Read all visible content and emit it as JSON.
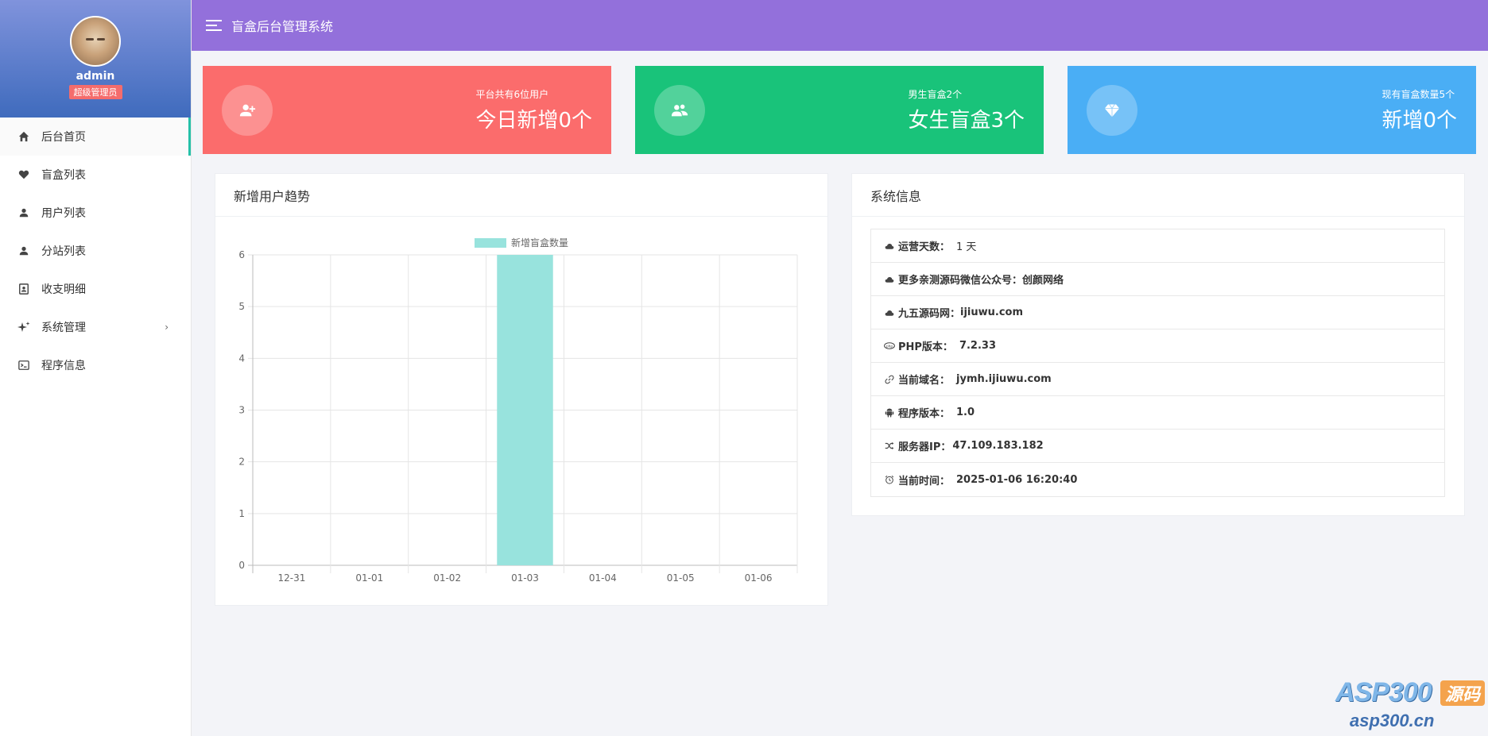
{
  "app": {
    "title": "盲盒后台管理系统"
  },
  "profile": {
    "username": "admin",
    "role": "超级管理员"
  },
  "sidebar": {
    "items": [
      {
        "label": "后台首页",
        "icon": "home-icon",
        "active": true
      },
      {
        "label": "盲盒列表",
        "icon": "heart-icon"
      },
      {
        "label": "用户列表",
        "icon": "user-icon"
      },
      {
        "label": "分站列表",
        "icon": "user-icon"
      },
      {
        "label": "收支明细",
        "icon": "contacts-icon"
      },
      {
        "label": "系统管理",
        "icon": "sparkle-icon",
        "has_submenu": true,
        "chevron": "›"
      },
      {
        "label": "程序信息",
        "icon": "terminal-icon"
      }
    ]
  },
  "stats": [
    {
      "small": "平台共有6位用户",
      "big": "今日新增0个",
      "color": "#fb6c6c",
      "icon": "user-plus-icon"
    },
    {
      "small": "男生盲盒2个",
      "big": "女生盲盒3个",
      "color": "#19c37a",
      "icon": "users-icon"
    },
    {
      "small": "现有盲盒数量5个",
      "big": "新增0个",
      "color": "#4aaef5",
      "icon": "diamond-icon"
    }
  ],
  "trend_panel": {
    "title": "新增用户趋势"
  },
  "chart_data": {
    "type": "bar",
    "categories": [
      "12-31",
      "01-01",
      "01-02",
      "01-03",
      "01-04",
      "01-05",
      "01-06"
    ],
    "series": [
      {
        "name": "新增盲盒数量",
        "values": [
          0,
          0,
          0,
          6,
          0,
          0,
          0
        ],
        "color": "#98e3dd"
      }
    ],
    "yticks": [
      "0",
      "1",
      "2",
      "3",
      "4",
      "5",
      "6"
    ],
    "ylim": [
      0,
      6
    ],
    "grid": true,
    "legend": "top-center"
  },
  "info_panel": {
    "title": "系统信息",
    "rows": [
      {
        "icon": "cloud-icon",
        "label": "运营天数：",
        "value": "1 天",
        "plain": true
      },
      {
        "icon": "cloud-icon",
        "label": "更多亲测源码微信公众号：",
        "value": "创颜网络"
      },
      {
        "icon": "cloud-icon",
        "label": "九五源码网：",
        "value": "ijiuwu.com"
      },
      {
        "icon": "php-icon",
        "label": "PHP版本：",
        "value": "7.2.33"
      },
      {
        "icon": "link-icon",
        "label": "当前域名：",
        "value": "jymh.ijiuwu.com"
      },
      {
        "icon": "android-icon",
        "label": "程序版本：",
        "value": "1.0"
      },
      {
        "icon": "shuffle-icon",
        "label": "服务器IP：",
        "value": "47.109.183.182"
      },
      {
        "icon": "alarm-clock-icon",
        "label": "当前时间：",
        "value": "2025-01-06 16:20:40"
      }
    ]
  },
  "watermark": {
    "brand": "ASP300",
    "badge": "源码",
    "url": "asp300.cn"
  }
}
